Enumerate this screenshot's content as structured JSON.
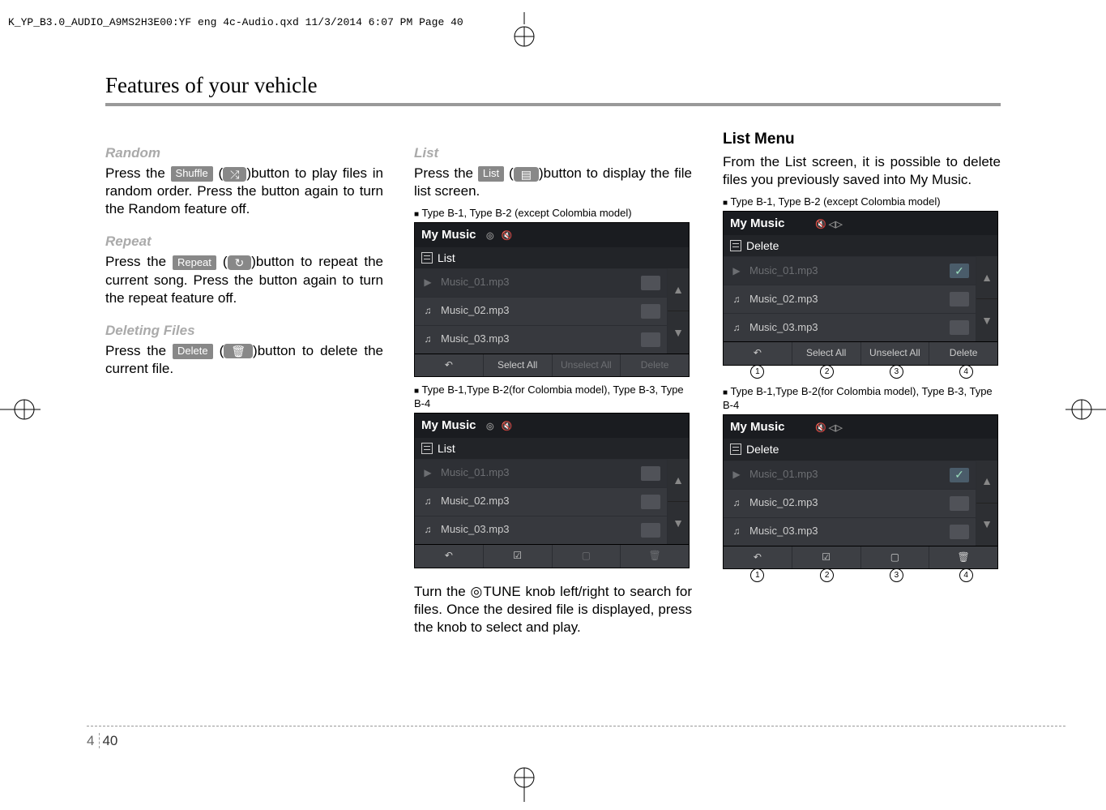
{
  "header_line": "K_YP_B3.0_AUDIO_A9MS2H3E00:YF eng 4c-Audio.qxd  11/3/2014  6:07 PM  Page 40",
  "section_title": "Features of your vehicle",
  "col1": {
    "random": {
      "title": "Random",
      "btn_label": "Shuffle",
      "pre": "Press the ",
      "post": "button to play files in random order. Press the button again to turn the Random feature off."
    },
    "repeat": {
      "title": "Repeat",
      "btn_label": "Repeat",
      "pre": "Press the ",
      "post": "button to repeat the current song. Press the button again to turn the repeat feature off."
    },
    "delete": {
      "title": "Deleting Files",
      "btn_label": "Delete",
      "pre": "Press the ",
      "post": "button to delete the current file."
    }
  },
  "col2": {
    "list": {
      "title": "List",
      "btn_label": "List",
      "pre": "Press the ",
      "post": "button to display the file list screen."
    },
    "caption1": "Type B-1, Type B-2 (except Colombia model)",
    "caption2": "Type B-1,Type B-2(for Colombia model), Type B-3, Type B-4",
    "screen": {
      "title": "My Music",
      "sub": "List",
      "rows": [
        "Music_01.mp3",
        "Music_02.mp3",
        "Music_03.mp3"
      ],
      "foot": {
        "back": "↶",
        "select_all": "Select All",
        "unselect_all": "Unselect All",
        "delete": "Delete"
      }
    },
    "tune_para": "Turn the  ◎TUNE  knob  left/right  to search for files. Once the desired file is displayed, press the knob to select and play."
  },
  "col3": {
    "title": "List Menu",
    "para": "From the List screen, it is possible to delete files you previously saved into My Music.",
    "caption1": "Type B-1, Type B-2 (except Colombia model)",
    "caption2": "Type B-1,Type B-2(for Colombia model), Type B-3, Type B-4",
    "screen": {
      "title": "My Music",
      "sub": "Delete",
      "rows": [
        "Music_01.mp3",
        "Music_02.mp3",
        "Music_03.mp3"
      ],
      "foot": {
        "back": "↶",
        "select_all": "Select All",
        "unselect_all": "Unselect All",
        "delete": "Delete"
      }
    },
    "callouts": [
      "1",
      "2",
      "3",
      "4"
    ]
  },
  "page": {
    "section": "4",
    "num": "40"
  }
}
